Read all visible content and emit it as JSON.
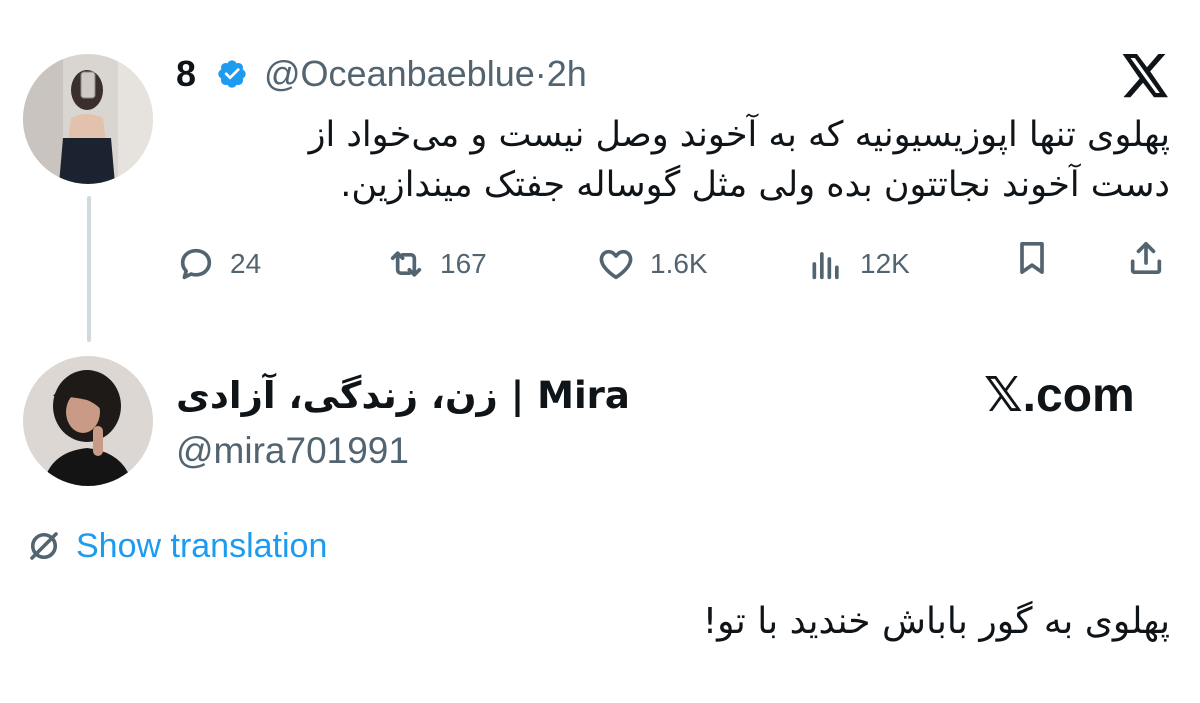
{
  "original_tweet": {
    "display_name": "8",
    "handle": "@Oceanbaeblue",
    "separator": "·",
    "time": "2h",
    "verified": true,
    "text_line1": "پهلوی تنها اپوزیسیونیه که به آخوند وصل نیست و می‌خواد از",
    "text_line2": "دست آخوند نجاتتون بده ولی مثل گوساله جفتک میندازین.",
    "platform_icon": "x-logo-icon",
    "actions": {
      "replies": "24",
      "retweets": "167",
      "likes": "1.6K",
      "views": "12K"
    }
  },
  "reply_tweet": {
    "display_name": "زن، زندگی، آزادی | Mira",
    "handle": "@mira701991",
    "site_label": "𝕏.com",
    "show_translation": "Show translation",
    "text": "پهلوی به گور باباش خندید با تو!"
  },
  "colors": {
    "text": "#0f1419",
    "secondary": "#536471",
    "link": "#1d9bf0",
    "verified_badge": "#1d9bf0",
    "thread_line": "#cfd9de"
  }
}
